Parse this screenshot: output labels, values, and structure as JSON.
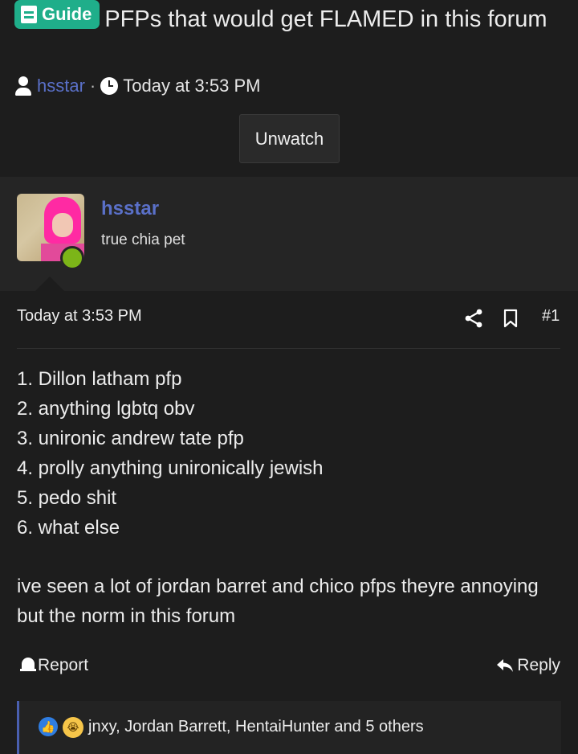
{
  "thread": {
    "prefix": "Guide",
    "title": "PFPs that would get FLAMED in this forum",
    "author": "hsstar",
    "separator": "·",
    "date": "Today at 3:53 PM",
    "unwatch_label": "Unwatch"
  },
  "post": {
    "username": "hsstar",
    "user_title": "true chia pet",
    "date": "Today at 3:53 PM",
    "number": "#1",
    "list": [
      "1. Dillon latham pfp",
      "2. anything lgbtq obv",
      "3. unironic andrew tate pfp",
      "4. prolly anything unironically jewish",
      "5. pedo shit",
      "6. what else"
    ],
    "paragraph": "ive seen a lot of jordan barret and chico pfps theyre annoying but the norm in this forum",
    "report_label": "Report",
    "reply_label": "Reply",
    "reactions_text": "jnxy, Jordan Barrett, HentaiHunter and 5 others"
  },
  "icons": {
    "badge": "document-icon",
    "author": "user-icon",
    "clock": "clock-icon",
    "share": "share-icon",
    "bookmark": "bookmark-icon",
    "report": "bell-icon",
    "reply": "reply-arrow-icon",
    "like": "like-icon",
    "sob": "crying-face-icon"
  },
  "colors": {
    "background": "#1d1d1d",
    "user_block": "#252525",
    "badge": "#1fae8a",
    "link": "#5a70c8",
    "online": "#7cb518",
    "reaction_border": "#4a5fb0"
  }
}
